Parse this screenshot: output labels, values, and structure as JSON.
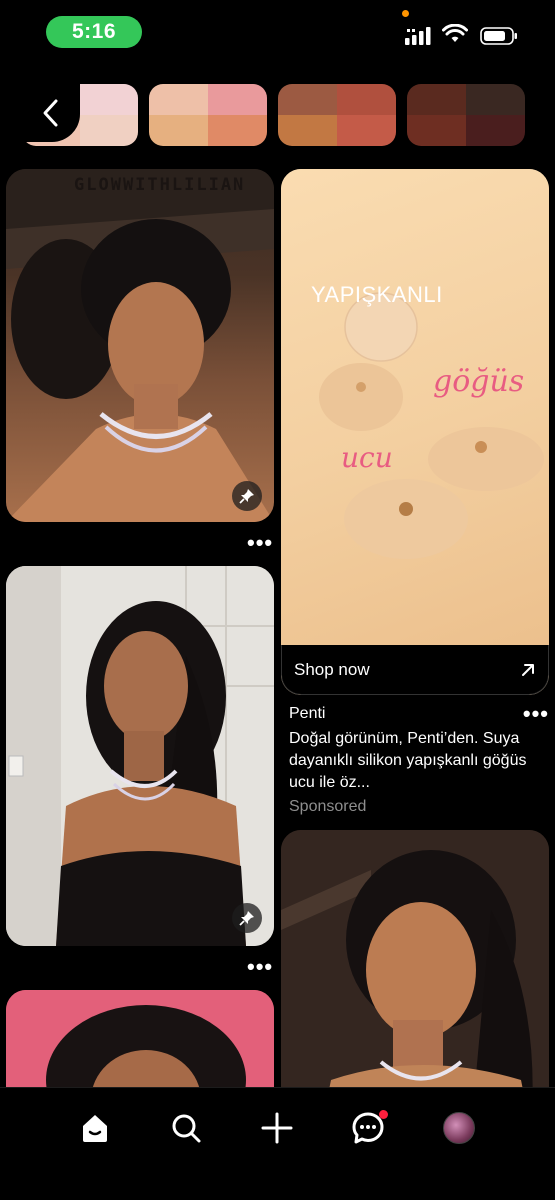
{
  "status_bar": {
    "time": "5:16"
  },
  "swatches": [
    {
      "colors": [
        "#f0d3cf",
        "#f2d2d4",
        "#f0c4b1",
        "#f0d0c2"
      ]
    },
    {
      "colors": [
        "#eec0a8",
        "#e99a9c",
        "#e6b080",
        "#e08a66"
      ]
    },
    {
      "colors": [
        "#9c5a42",
        "#b0503e",
        "#c27843",
        "#c45b48"
      ]
    },
    {
      "colors": [
        "#5a2a1f",
        "#3a2822",
        "#6e2e22",
        "#4a1e1e"
      ]
    }
  ],
  "pins": {
    "pin1_title": "GLOWWITHLILIAN"
  },
  "ad": {
    "headline": "YAPIŞKANLI",
    "script_word_1": "göğüs",
    "script_word_2": "ucu",
    "cta_label": "Shop now",
    "brand": "Penti",
    "description": "Doğal görünüm, Penti’den. Suya dayanıklı silikon yapışkanlı göğüs ucu ile öz...",
    "sponsored": "Sponsored"
  },
  "more_label": "•••",
  "nav": {
    "items": [
      "home-icon",
      "search-icon",
      "plus-icon",
      "messages-icon",
      "profile-avatar"
    ]
  }
}
